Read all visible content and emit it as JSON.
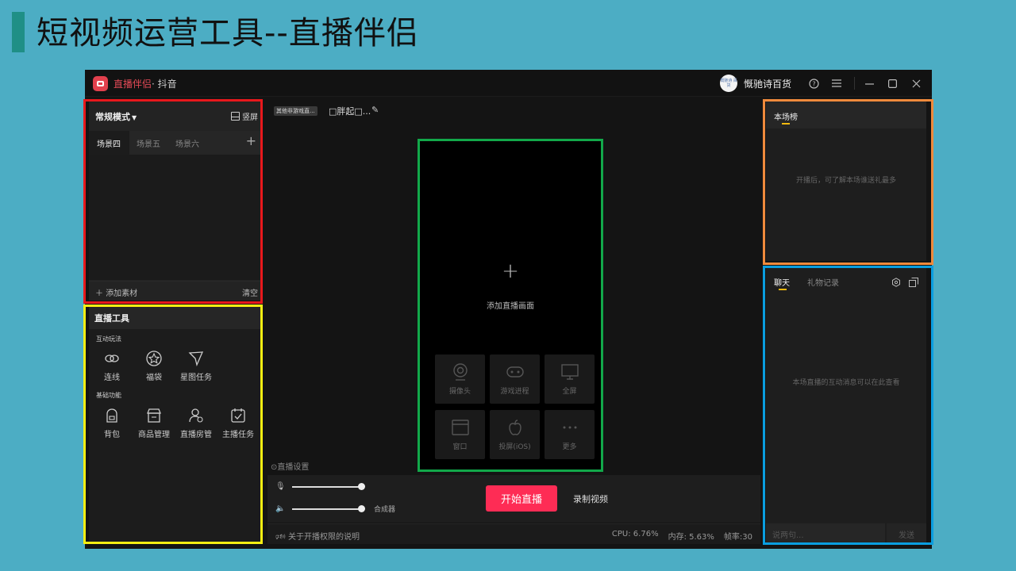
{
  "slide": {
    "title": "短视频运营工具--直播伴侣"
  },
  "titlebar": {
    "app_name": "直播伴侣",
    "platform": "· 抖音",
    "user_avatar_text": "慨驰诗 百货",
    "user_name": "慨驰诗百货"
  },
  "scenes": {
    "mode": "常规模式",
    "vertical_screen": "竖屏",
    "tabs": [
      "场景四",
      "场景五",
      "场景六"
    ],
    "add_material": "添加素材",
    "clear": "清空"
  },
  "tools": {
    "title": "直播工具",
    "interactive_label": "互动玩法",
    "interactive": [
      {
        "label": "连线",
        "icon": "link-icon"
      },
      {
        "label": "福袋",
        "icon": "lucky-bag-icon"
      },
      {
        "label": "星图任务",
        "icon": "star-task-icon"
      }
    ],
    "basic_label": "基础功能",
    "basic": [
      {
        "label": "背包",
        "icon": "backpack-icon"
      },
      {
        "label": "商品管理",
        "icon": "product-icon"
      },
      {
        "label": "直播房管",
        "icon": "room-admin-icon"
      },
      {
        "label": "主播任务",
        "icon": "anchor-task-icon"
      }
    ]
  },
  "center": {
    "category_tag": "其他非游戏直...",
    "room_title": "□胖起□...",
    "add_screen": "添加直播画面",
    "sources": [
      {
        "label": "摄像头",
        "icon": "camera-icon"
      },
      {
        "label": "游戏进程",
        "icon": "gamepad-icon"
      },
      {
        "label": "全屏",
        "icon": "monitor-icon"
      },
      {
        "label": "窗口",
        "icon": "window-icon"
      },
      {
        "label": "投屏(iOS)",
        "icon": "apple-icon"
      },
      {
        "label": "更多",
        "icon": "more-icon"
      }
    ],
    "live_settings": "直播设置",
    "mixer": "合成器",
    "mic_level": 1.0,
    "speaker_level": 1.0,
    "start_live": "开始直播",
    "record_video": "录制视频",
    "permission_note": "关于开播权限的说明",
    "cpu": "CPU: 6.76%",
    "memory": "内存: 5.63%",
    "fps": "帧率:30"
  },
  "ranking": {
    "tab": "本场榜",
    "empty": "开播后，可了解本场谁送礼最多"
  },
  "chat": {
    "tab_chat": "聊天",
    "tab_gifts": "礼物记录",
    "empty": "本场直播的互动消息可以在此查看",
    "input_placeholder": "说两句...",
    "send": "发送"
  },
  "highlights": {
    "scenes": "#e8181c",
    "tools": "#f6ee12",
    "preview": "#12a84a",
    "ranking": "#ef8a3c",
    "chat": "#0a9ee0"
  }
}
